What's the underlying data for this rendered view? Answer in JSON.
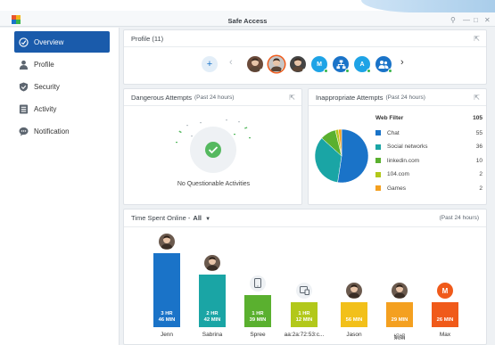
{
  "window": {
    "title": "Safe Access"
  },
  "sidebar": {
    "items": [
      {
        "label": "Overview",
        "icon": "speedometer-icon"
      },
      {
        "label": "Profile",
        "icon": "person-icon"
      },
      {
        "label": "Security",
        "icon": "shield-icon"
      },
      {
        "label": "Activity",
        "icon": "list-icon"
      },
      {
        "label": "Notification",
        "icon": "speech-bubble-icon"
      }
    ]
  },
  "profile": {
    "title": "Profile (11)",
    "avatars": [
      {
        "kind": "photo",
        "color": "#6b4a3a"
      },
      {
        "kind": "photo",
        "color": "#c7c7c7"
      },
      {
        "kind": "photo",
        "color": "#444444"
      },
      {
        "kind": "letter",
        "letter": "M",
        "color": "#1ea3e6"
      },
      {
        "kind": "network",
        "color": "#1a73c8"
      },
      {
        "kind": "letter",
        "letter": "A",
        "color": "#1ea3e6"
      },
      {
        "kind": "group",
        "color": "#1a73c8"
      }
    ]
  },
  "dangerous": {
    "title": "Dangerous Attempts",
    "sub": "(Past 24 hours)",
    "empty_text": "No Questionable Activities"
  },
  "inappropriate": {
    "title": "Inappropriate Attempts",
    "sub": "(Past 24 hours)",
    "legend_header": "Web Filter",
    "legend_total": "105",
    "items": [
      {
        "label": "Chat",
        "value": "55",
        "color": "#1a73c8"
      },
      {
        "label": "Social networks",
        "value": "36",
        "color": "#1aa5a5"
      },
      {
        "label": "linkedin.com",
        "value": "10",
        "color": "#5ab02f"
      },
      {
        "label": "104.com",
        "value": "2",
        "color": "#b2c81a"
      },
      {
        "label": "Games",
        "value": "2",
        "color": "#f4a020"
      }
    ]
  },
  "time_spent": {
    "title": "Time Spent Online -",
    "filter": "All",
    "range": "(Past 24 hours)"
  },
  "chart_data": {
    "type": "bar",
    "categories": [
      "Jenn",
      "Sabrina",
      "Spree",
      "aa:2a:72:53:c...",
      "Jason",
      "娟娟",
      "Max"
    ],
    "values_minutes": [
      226,
      162,
      99,
      72,
      56,
      29,
      26
    ],
    "value_labels": [
      [
        "3 HR",
        "46 MIN"
      ],
      [
        "2 HR",
        "42 MIN"
      ],
      [
        "1 HR",
        "39 MIN"
      ],
      [
        "1 HR",
        "12 MIN"
      ],
      [
        "56 MIN"
      ],
      [
        "29 MIN"
      ],
      [
        "26 MIN"
      ]
    ],
    "colors": [
      "#1a73c8",
      "#1aa5a5",
      "#5ab02f",
      "#b2c81a",
      "#f2c01a",
      "#f4a020",
      "#f05a1a"
    ],
    "avatars": [
      "photo",
      "photo",
      "phone-icon",
      "tablet-icon",
      "photo",
      "photo",
      "letter-M"
    ]
  }
}
